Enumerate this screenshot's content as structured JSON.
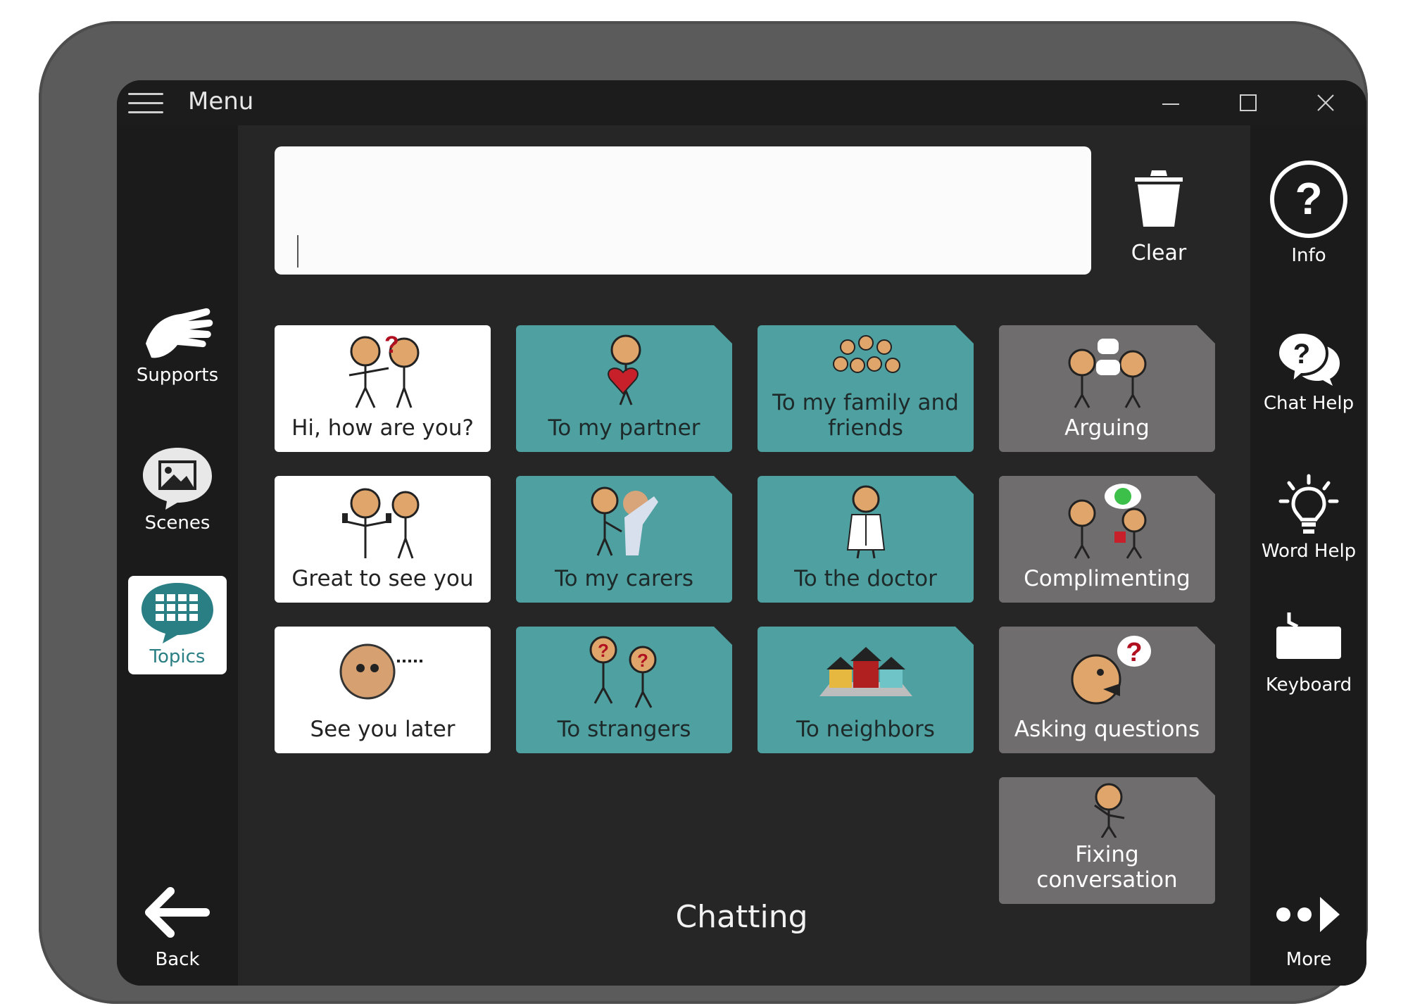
{
  "titlebar": {
    "menu_label": "Menu",
    "icons": [
      "hamburger-icon",
      "minimize-icon",
      "maximize-icon",
      "close-icon"
    ]
  },
  "left_nav": {
    "supports": "Supports",
    "scenes": "Scenes",
    "topics": "Topics",
    "back": "Back"
  },
  "right_nav": {
    "info": "Info",
    "chat_help": "Chat Help",
    "word_help": "Word Help",
    "keyboard": "Keyboard",
    "more": "More"
  },
  "message": {
    "value": ""
  },
  "toolbar": {
    "clear_label": "Clear"
  },
  "grid": {
    "greetings": [
      "Hi, how are you?",
      "Great to see you",
      "See you later"
    ],
    "people": [
      "To my partner",
      "To my carers",
      "To strangers"
    ],
    "people2": [
      "To my family and friends",
      "To the doctor",
      "To neighbors"
    ],
    "skills": [
      "Arguing",
      "Complimenting",
      "Asking questions",
      "Fixing conversation"
    ]
  },
  "page": {
    "title": "Chatting"
  },
  "colors": {
    "teal": "#4fa0a1",
    "grey": "#6f6d6d",
    "white": "#ffffff",
    "frame": "#5b5b5b",
    "accent_text": "#2a7f84"
  }
}
